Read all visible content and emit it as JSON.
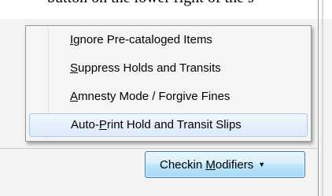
{
  "cut_off_text": "button on the lower right of the s",
  "menu": {
    "items": [
      {
        "before": "",
        "mnemonic": "I",
        "after": "gnore Pre-cataloged Items"
      },
      {
        "before": "",
        "mnemonic": "S",
        "after": "uppress Holds and Transits"
      },
      {
        "before": "",
        "mnemonic": "A",
        "after": "mnesty Mode / Forgive Fines"
      },
      {
        "before": "Auto-",
        "mnemonic": "P",
        "after": "rint Hold and Transit Slips"
      }
    ],
    "hovered_index": 3
  },
  "button": {
    "label_before": "Checkin ",
    "mnemonic": "M",
    "label_after": "odifiers",
    "icon": "caret-down-icon"
  }
}
